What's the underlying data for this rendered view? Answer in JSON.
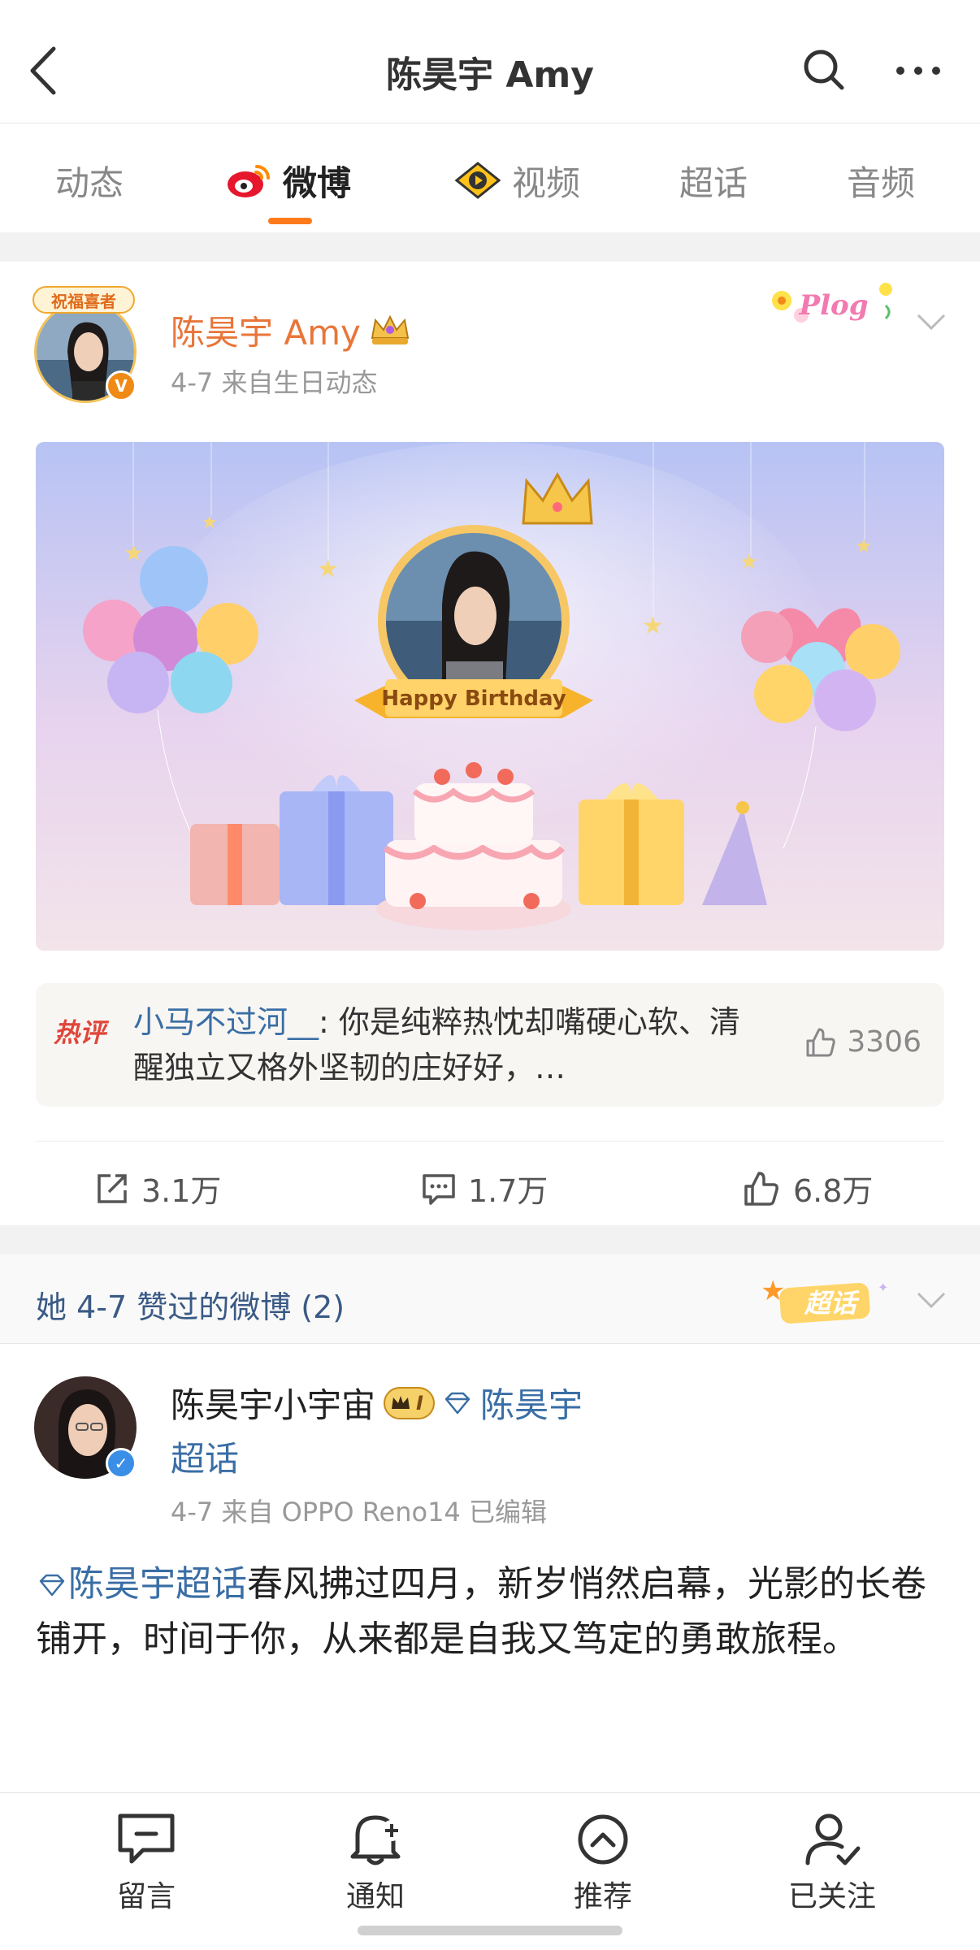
{
  "header": {
    "title": "陈昊宇 Amy"
  },
  "tabs": [
    {
      "label": "动态"
    },
    {
      "label": "微博"
    },
    {
      "label": "视频"
    },
    {
      "label": "超话"
    },
    {
      "label": "音频"
    }
  ],
  "post1": {
    "avatar_frame_text": "祝福喜者",
    "author": "陈昊宇 Amy",
    "meta": "4-7  来自生日动态",
    "sticker_text": "Plog",
    "banner_text": "Happy Birthday",
    "hot_comment": {
      "tag": "热评",
      "user": "小马不过河__",
      "text": ": 你是纯粹热忱却嘴硬心软、清醒独立又格外坚韧的庄好好，…",
      "likes": "3306"
    },
    "actions": {
      "repost": "3.1万",
      "comment": "1.7万",
      "like": "6.8万"
    }
  },
  "liked_section": {
    "title": "她 4-7 赞过的微博 (2)",
    "sticker_text": "超话"
  },
  "post2": {
    "author": "陈昊宇小宇宙",
    "badge_level": "I",
    "topic_tag_line1": "陈昊宇",
    "topic_tag_line2": "超话",
    "meta": "4-7  来自 OPPO Reno14  已编辑",
    "topic_link": "陈昊宇超话",
    "body": "春风拂过四月，新岁悄然启幕，光影的长卷铺开，时间于你，从来都是自我又笃定的勇敢旅程。"
  },
  "bottom_bar": [
    {
      "label": "留言"
    },
    {
      "label": "通知"
    },
    {
      "label": "推荐"
    },
    {
      "label": "已关注"
    }
  ],
  "colors": {
    "accent_orange": "#ff7a1a",
    "link_blue": "#3a6ea5",
    "author_orange": "#e8763a",
    "hot_red": "#e0463a"
  }
}
